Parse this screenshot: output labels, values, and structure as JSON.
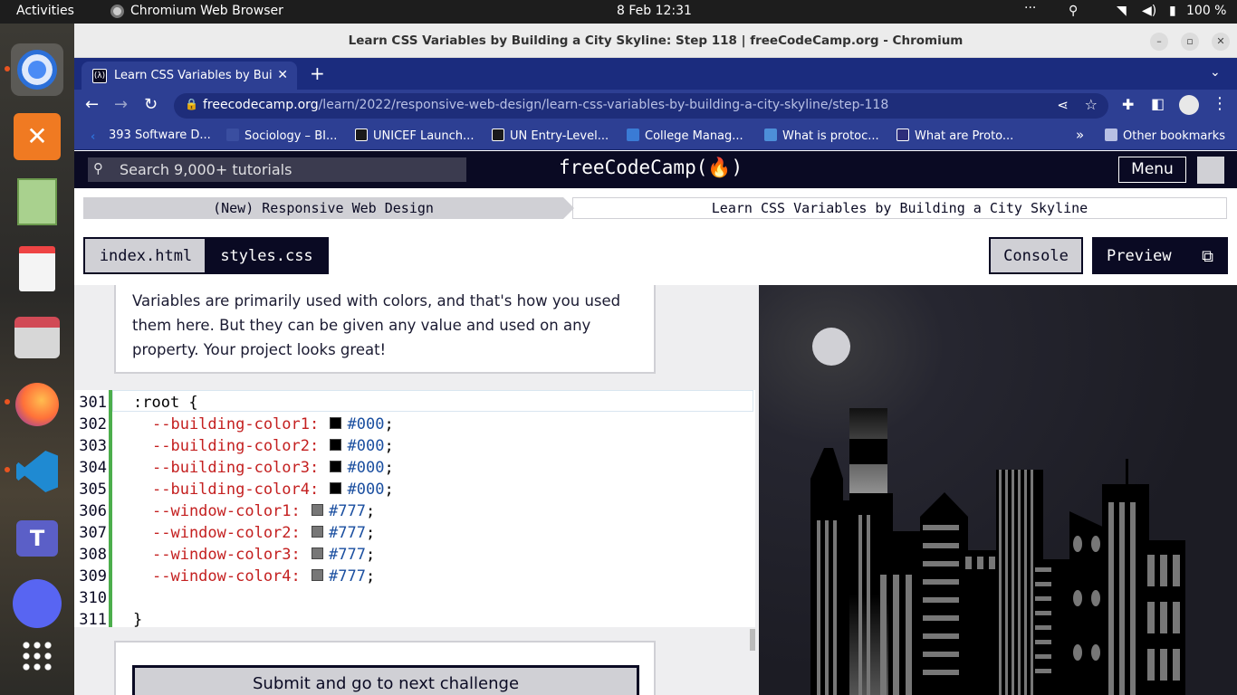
{
  "system": {
    "activities": "Activities",
    "app_name": "Chromium Web Browser",
    "datetime": "8 Feb  12:31",
    "battery": "100 %"
  },
  "window": {
    "title": "Learn CSS Variables by Building a City Skyline: Step 118 | freeCodeCamp.org - Chromium"
  },
  "browser": {
    "tab_title": "Learn CSS Variables by Bui",
    "url_domain": "freecodecamp.org",
    "url_path": "/learn/2022/responsive-web-design/learn-css-variables-by-building-a-city-skyline/step-118",
    "bookmarks": [
      {
        "label": "393 Software D...",
        "color": "#2f6fd6"
      },
      {
        "label": "Sociology – BI...",
        "color": "#3a4ea0"
      },
      {
        "label": "UNICEF Launch...",
        "color": "#1a1a1a"
      },
      {
        "label": "UN Entry-Level...",
        "color": "#1a1a1a"
      },
      {
        "label": "College Manag...",
        "color": "#3a7bd5"
      },
      {
        "label": "What is protoc...",
        "color": "#4d8fd8"
      },
      {
        "label": "What are Proto...",
        "color": "#2d2d7a"
      }
    ],
    "other_bookmarks": "Other bookmarks"
  },
  "fcc": {
    "search_placeholder": "Search 9,000+ tutorials",
    "logo": "freeCodeCamp(🔥)",
    "menu": "Menu",
    "breadcrumb_course": "(New) Responsive Web Design",
    "breadcrumb_project": "Learn CSS Variables by Building a City Skyline",
    "file_tabs": [
      "index.html",
      "styles.css"
    ],
    "console": "Console",
    "preview": "Preview",
    "description": "Variables are primarily used with colors, and that's how you used them here. But they can be given any value and used on any property. Your project looks great!",
    "submit": "Submit and go to next challenge"
  },
  "code_lines": [
    {
      "num": "301",
      "text": ":root {"
    },
    {
      "num": "302",
      "prop": "--building-color1:",
      "color": "#000000",
      "val": "#000"
    },
    {
      "num": "303",
      "prop": "--building-color2:",
      "color": "#000000",
      "val": "#000"
    },
    {
      "num": "304",
      "prop": "--building-color3:",
      "color": "#000000",
      "val": "#000"
    },
    {
      "num": "305",
      "prop": "--building-color4:",
      "color": "#000000",
      "val": "#000"
    },
    {
      "num": "306",
      "prop": "--window-color1:",
      "color": "#777777",
      "val": "#777"
    },
    {
      "num": "307",
      "prop": "--window-color2:",
      "color": "#777777",
      "val": "#777"
    },
    {
      "num": "308",
      "prop": "--window-color3:",
      "color": "#777777",
      "val": "#777"
    },
    {
      "num": "309",
      "prop": "--window-color4:",
      "color": "#777777",
      "val": "#777"
    },
    {
      "num": "310",
      "text": ""
    },
    {
      "num": "311",
      "text": "}"
    }
  ]
}
